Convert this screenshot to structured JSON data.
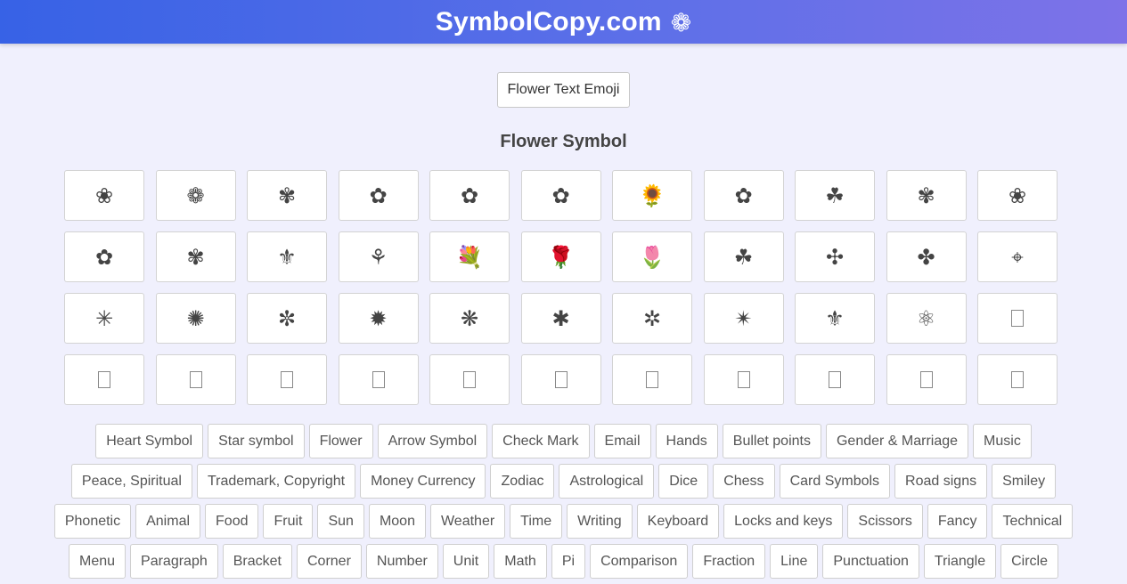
{
  "header": {
    "title": "SymbolCopy.com",
    "logo_glyph": "❁"
  },
  "top_button": {
    "label": "Flower Text Emoji"
  },
  "section": {
    "title": "Flower Symbol"
  },
  "symbols": [
    "❀",
    "❁",
    "✾",
    "✿",
    "✿",
    "✿",
    "🌻",
    "✿",
    "☘",
    "✾",
    "❀",
    "✿",
    "✾",
    "⚜",
    "⚘",
    "💐",
    "🌹",
    "🌷",
    "☘",
    "✣",
    "✤",
    "⌖",
    "✳",
    "✺",
    "✼",
    "✹",
    "❋",
    "✱",
    "✲",
    "✴",
    "⚜",
    "⚛",
    "",
    "",
    "",
    "",
    "",
    "",
    "",
    "",
    "",
    "",
    "",
    ""
  ],
  "categories": [
    [
      "Heart Symbol",
      "Star symbol",
      "Flower",
      "Arrow Symbol",
      "Check Mark",
      "Email",
      "Hands",
      "Bullet points",
      "Gender & Marriage",
      "Music"
    ],
    [
      "Peace, Spiritual",
      "Trademark, Copyright",
      "Money Currency",
      "Zodiac",
      "Astrological",
      "Dice",
      "Chess",
      "Card Symbols",
      "Road signs",
      "Smiley"
    ],
    [
      "Phonetic",
      "Animal",
      "Food",
      "Fruit",
      "Sun",
      "Moon",
      "Weather",
      "Time",
      "Writing",
      "Keyboard",
      "Locks and keys",
      "Scissors",
      "Fancy",
      "Technical"
    ],
    [
      "Menu",
      "Paragraph",
      "Bracket",
      "Corner",
      "Number",
      "Unit",
      "Math",
      "Pi",
      "Comparison",
      "Fraction",
      "Line",
      "Punctuation",
      "Triangle",
      "Circle"
    ]
  ]
}
